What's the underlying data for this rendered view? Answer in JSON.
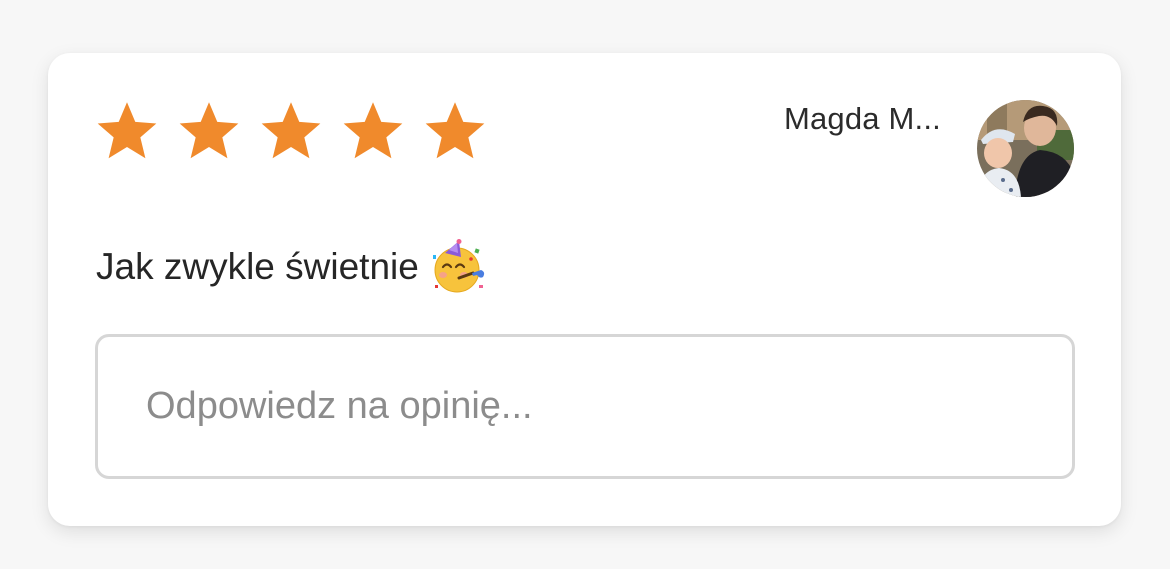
{
  "review": {
    "rating": 5,
    "rating_max": 5,
    "star_color": "#f08a2c",
    "author_name": "Magda M...",
    "text": "Jak zwykle świetnie",
    "emoji": "partying-face",
    "avatar_icon": "user-photo-avatar"
  },
  "reply": {
    "placeholder": "Odpowiedz na opinię..."
  }
}
